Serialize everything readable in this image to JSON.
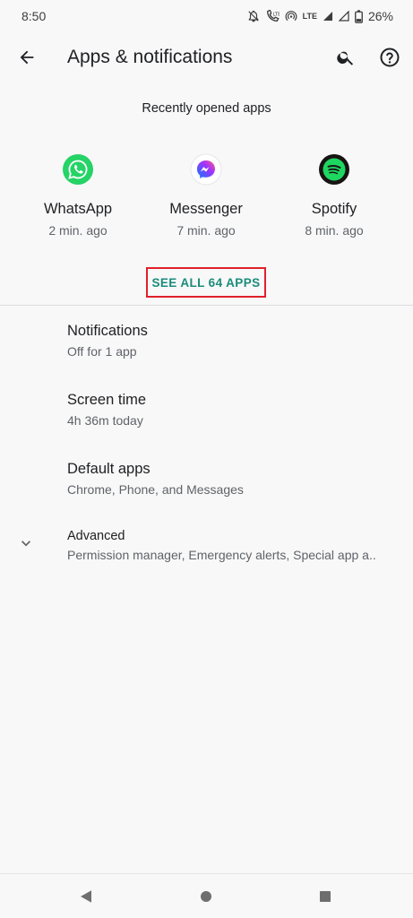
{
  "status_bar": {
    "time": "8:50",
    "network": "LTE",
    "battery": "26%",
    "icons": [
      "notifications-off-icon",
      "wifi-calling-icon",
      "hotspot-icon",
      "lte-signal-icon",
      "signal-icon",
      "battery-icon"
    ]
  },
  "app_bar": {
    "title": "Apps & notifications",
    "icons": [
      "back-arrow-icon",
      "search-icon",
      "help-icon"
    ]
  },
  "recent": {
    "header": "Recently opened apps",
    "apps": [
      {
        "name": "WhatsApp",
        "time": "2 min. ago",
        "icon": "whatsapp-icon",
        "color": "#25d366"
      },
      {
        "name": "Messenger",
        "time": "7 min. ago",
        "icon": "messenger-icon",
        "color": "#a033ff"
      },
      {
        "name": "Spotify",
        "time": "8 min. ago",
        "icon": "spotify-icon",
        "color": "#1ed760"
      }
    ],
    "see_all_label": "SEE ALL 64 APPS",
    "highlight_color": "#e0202a",
    "accent_color": "#1a8c7b"
  },
  "preferences": [
    {
      "title": "Notifications",
      "summary": "Off for 1 app"
    },
    {
      "title": "Screen time",
      "summary": "4h 36m today"
    },
    {
      "title": "Default apps",
      "summary": "Chrome, Phone, and Messages"
    },
    {
      "title": "Advanced",
      "summary": "Permission manager, Emergency alerts, Special app a.."
    }
  ],
  "nav_bar": {
    "icons": [
      "back-triangle-icon",
      "home-circle-icon",
      "recents-square-icon"
    ]
  }
}
